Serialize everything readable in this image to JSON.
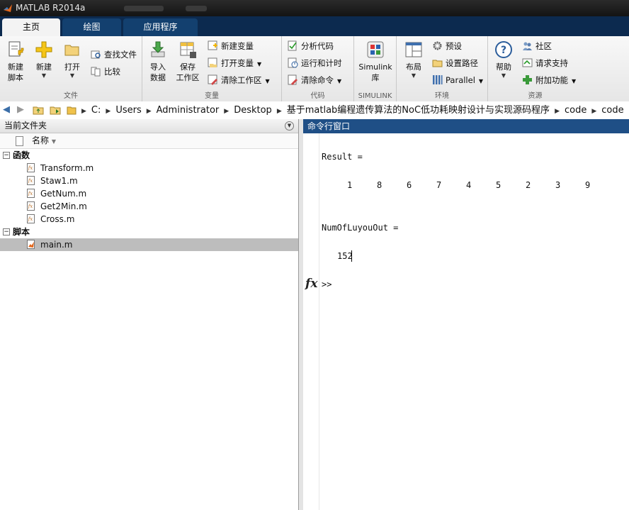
{
  "app": {
    "title": "MATLAB R2014a"
  },
  "tabs": [
    {
      "label": "主页",
      "active": true
    },
    {
      "label": "绘图"
    },
    {
      "label": "应用程序"
    }
  ],
  "ribbon": {
    "file": {
      "label": "文件",
      "new_script": "新建\n脚本",
      "new": "新建",
      "open": "打开",
      "find_files": "查找文件",
      "compare": "比较"
    },
    "variable": {
      "label": "变量",
      "import": "导入\n数据",
      "save": "保存\n工作区",
      "new_var": "新建变量",
      "open_var": "打开变量",
      "clear_ws": "清除工作区"
    },
    "code": {
      "label": "代码",
      "analyze": "分析代码",
      "run_time": "运行和计时",
      "clear_cmd": "清除命令"
    },
    "simulink": {
      "label": "SIMULINK",
      "btn": "Simulink\n库"
    },
    "env": {
      "label": "环境",
      "layout": "布局",
      "prefs": "预设",
      "set_path": "设置路径",
      "parallel": "Parallel"
    },
    "resources": {
      "label": "资源",
      "help": "帮助",
      "community": "社区",
      "support": "请求支持",
      "addons": "附加功能"
    }
  },
  "address": {
    "path": [
      "C:",
      "Users",
      "Administrator",
      "Desktop",
      "基于matlab编程遗传算法的NoC低功耗映射设计与实现源码程序",
      "code",
      "code"
    ]
  },
  "folder_panel": {
    "title": "当前文件夹",
    "column": "名称",
    "groups": [
      {
        "name": "函数",
        "files": [
          "Transform.m",
          "Staw1.m",
          "GetNum.m",
          "Get2Min.m",
          "Cross.m"
        ]
      },
      {
        "name": "脚本",
        "files": [
          "main.m"
        ]
      }
    ]
  },
  "command_window": {
    "title": "命令行窗口",
    "result_label": "Result =",
    "result_values": [
      "1",
      "8",
      "6",
      "7",
      "4",
      "5",
      "2",
      "3",
      "9"
    ],
    "num_label": "NumOfLuyouOut =",
    "num_value": "152",
    "fx": "fx",
    "prompt": ">>"
  },
  "colors": {
    "tab_strip": "#0c2a4f",
    "cmd_header": "#1f4f86",
    "selected_row": "#bdbdbd"
  }
}
